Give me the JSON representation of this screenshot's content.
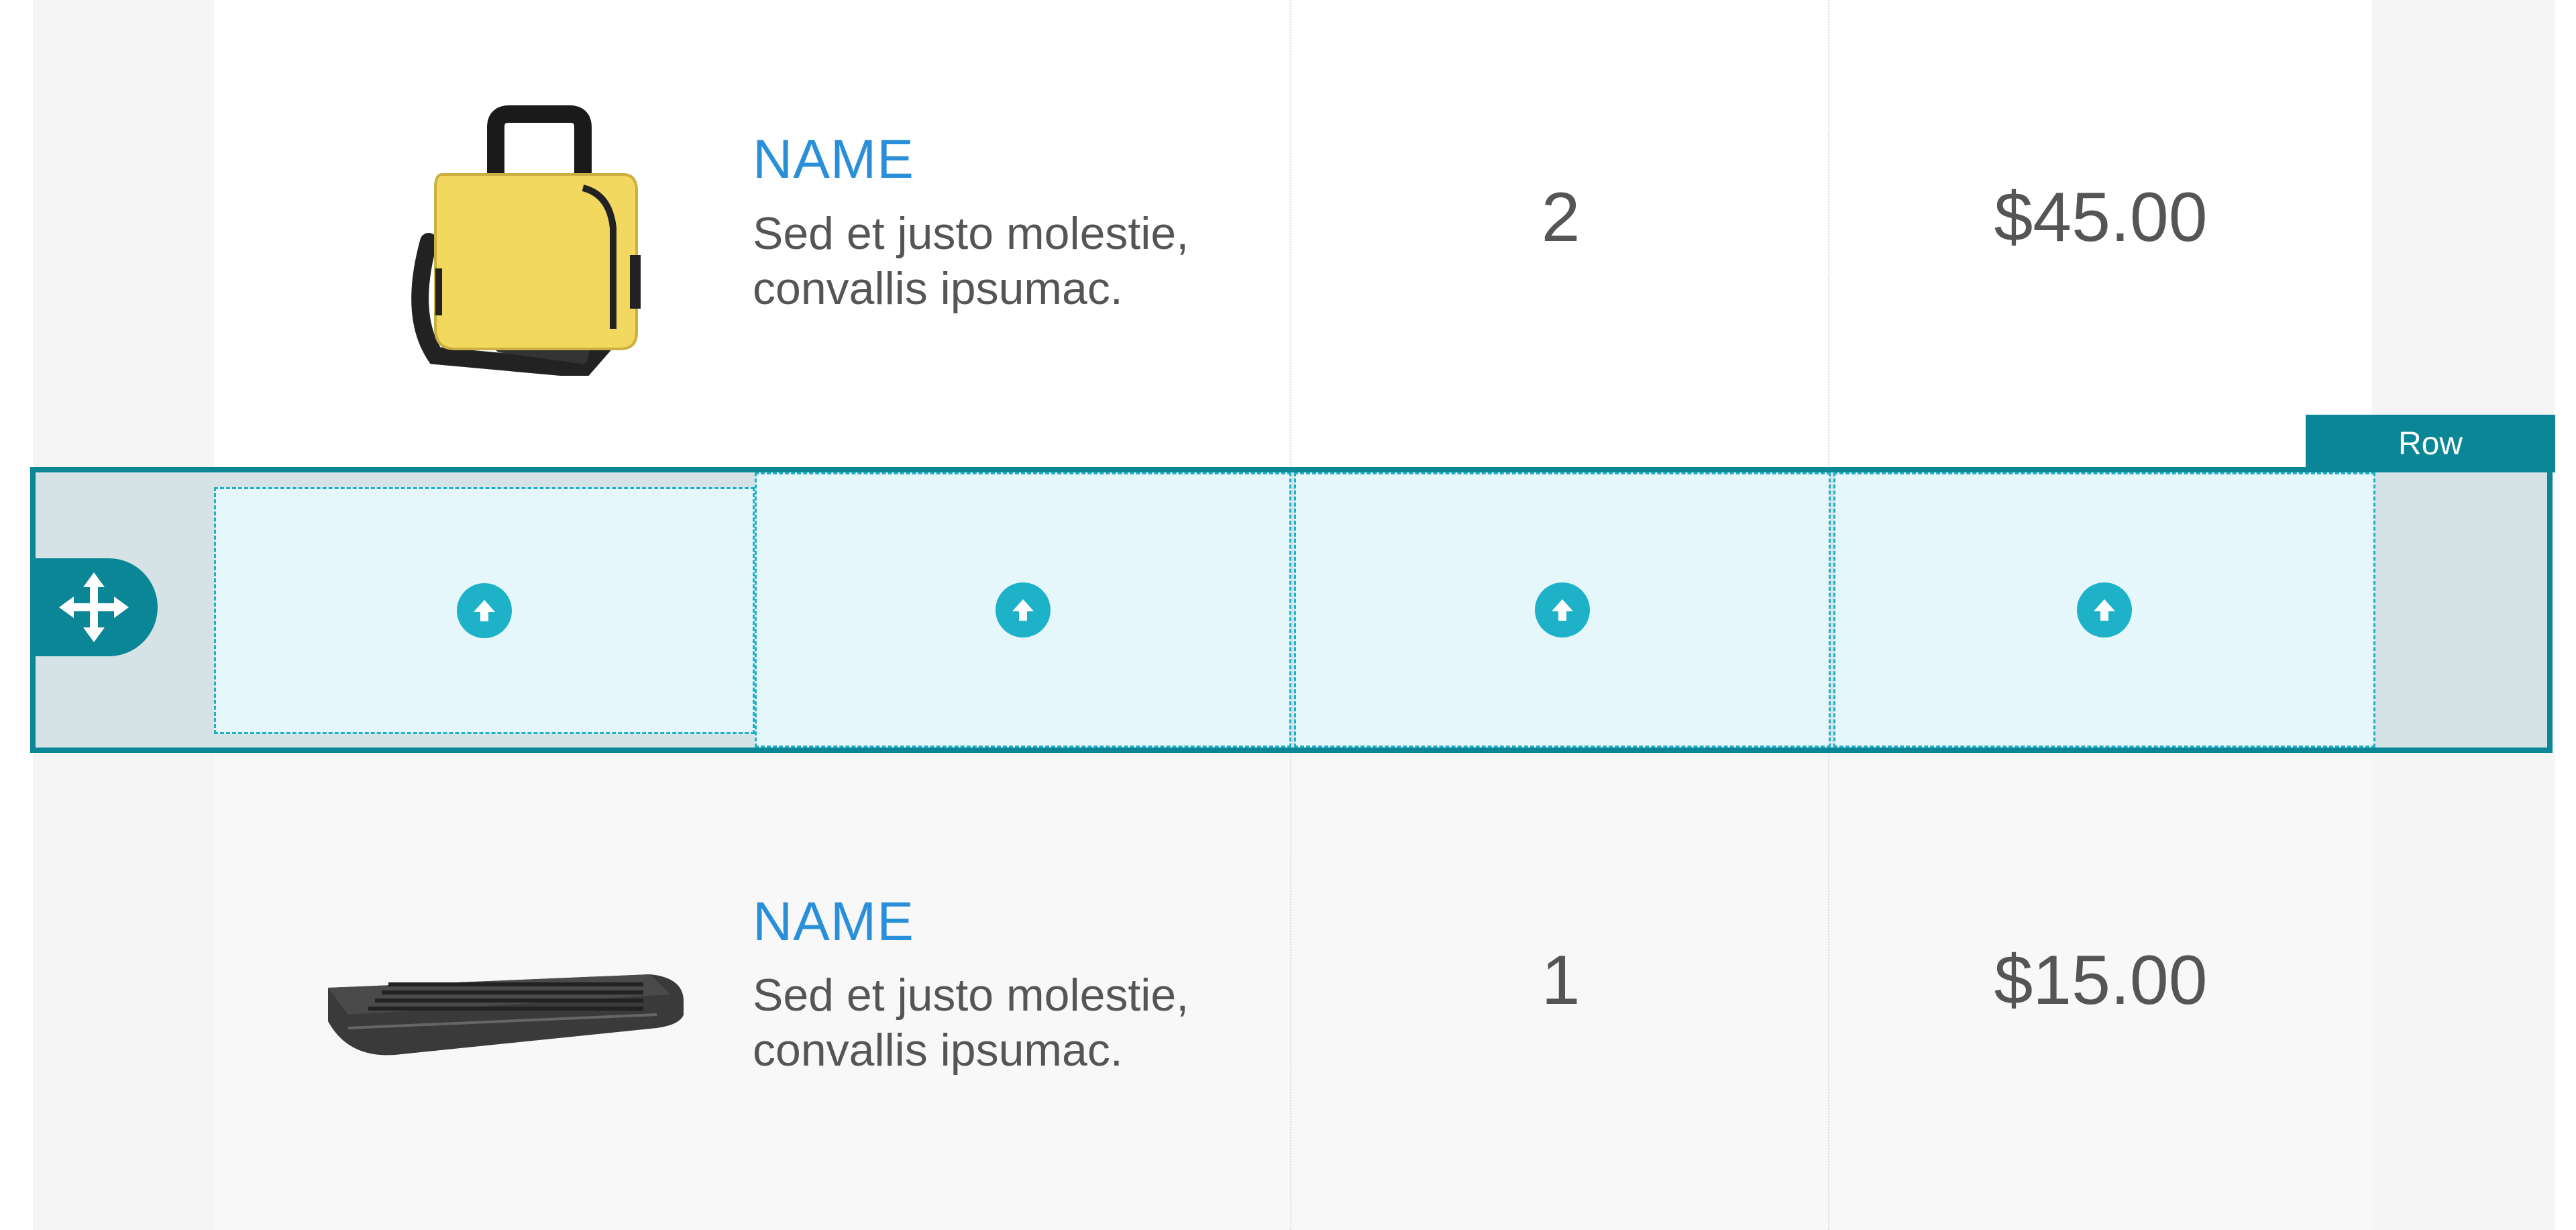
{
  "rows": [
    {
      "image": "yellow-laptop-bag",
      "name": "NAME",
      "description_line1": "Sed et justo molestie,",
      "description_line2": "convallis ipsumac.",
      "quantity": "2",
      "price": "$45.00"
    },
    {
      "image": "black-keyboard",
      "name": "NAME",
      "description_line1": "Sed et justo molestie,",
      "description_line2": "convallis ipsumac.",
      "quantity": "1",
      "price": "$15.00"
    }
  ],
  "selected_row": {
    "label": "Row",
    "drop_zone_icon": "upload-arrow-icon",
    "move_icon": "move-arrows-icon",
    "column_count": 4
  },
  "colors": {
    "accent": "#0a8696",
    "drop_zone_icon": "#1db2c8",
    "name_link": "#2a8fd9",
    "text": "#555555"
  }
}
